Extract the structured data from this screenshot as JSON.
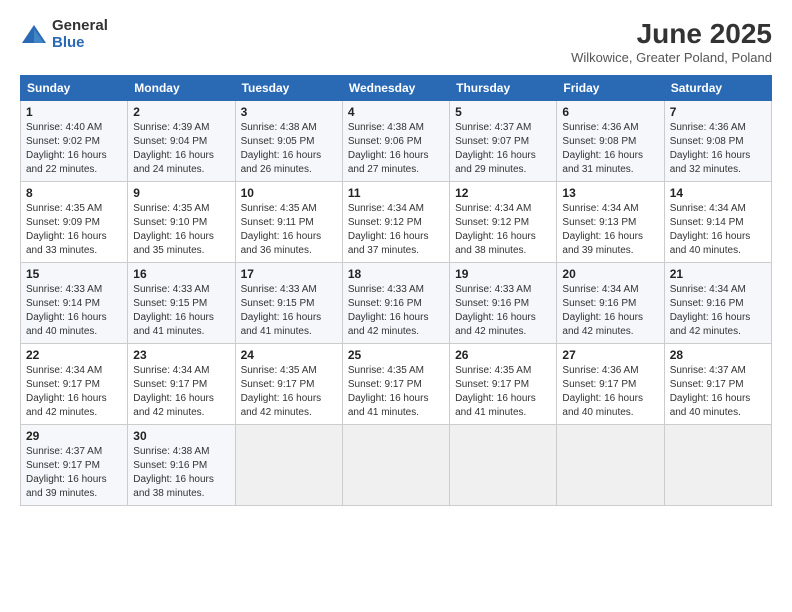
{
  "header": {
    "logo_general": "General",
    "logo_blue": "Blue",
    "month": "June 2025",
    "location": "Wilkowice, Greater Poland, Poland"
  },
  "days_of_week": [
    "Sunday",
    "Monday",
    "Tuesday",
    "Wednesday",
    "Thursday",
    "Friday",
    "Saturday"
  ],
  "weeks": [
    [
      {
        "day": "1",
        "sunrise": "Sunrise: 4:40 AM",
        "sunset": "Sunset: 9:02 PM",
        "daylight": "Daylight: 16 hours and 22 minutes."
      },
      {
        "day": "2",
        "sunrise": "Sunrise: 4:39 AM",
        "sunset": "Sunset: 9:04 PM",
        "daylight": "Daylight: 16 hours and 24 minutes."
      },
      {
        "day": "3",
        "sunrise": "Sunrise: 4:38 AM",
        "sunset": "Sunset: 9:05 PM",
        "daylight": "Daylight: 16 hours and 26 minutes."
      },
      {
        "day": "4",
        "sunrise": "Sunrise: 4:38 AM",
        "sunset": "Sunset: 9:06 PM",
        "daylight": "Daylight: 16 hours and 27 minutes."
      },
      {
        "day": "5",
        "sunrise": "Sunrise: 4:37 AM",
        "sunset": "Sunset: 9:07 PM",
        "daylight": "Daylight: 16 hours and 29 minutes."
      },
      {
        "day": "6",
        "sunrise": "Sunrise: 4:36 AM",
        "sunset": "Sunset: 9:08 PM",
        "daylight": "Daylight: 16 hours and 31 minutes."
      },
      {
        "day": "7",
        "sunrise": "Sunrise: 4:36 AM",
        "sunset": "Sunset: 9:08 PM",
        "daylight": "Daylight: 16 hours and 32 minutes."
      }
    ],
    [
      {
        "day": "8",
        "sunrise": "Sunrise: 4:35 AM",
        "sunset": "Sunset: 9:09 PM",
        "daylight": "Daylight: 16 hours and 33 minutes."
      },
      {
        "day": "9",
        "sunrise": "Sunrise: 4:35 AM",
        "sunset": "Sunset: 9:10 PM",
        "daylight": "Daylight: 16 hours and 35 minutes."
      },
      {
        "day": "10",
        "sunrise": "Sunrise: 4:35 AM",
        "sunset": "Sunset: 9:11 PM",
        "daylight": "Daylight: 16 hours and 36 minutes."
      },
      {
        "day": "11",
        "sunrise": "Sunrise: 4:34 AM",
        "sunset": "Sunset: 9:12 PM",
        "daylight": "Daylight: 16 hours and 37 minutes."
      },
      {
        "day": "12",
        "sunrise": "Sunrise: 4:34 AM",
        "sunset": "Sunset: 9:12 PM",
        "daylight": "Daylight: 16 hours and 38 minutes."
      },
      {
        "day": "13",
        "sunrise": "Sunrise: 4:34 AM",
        "sunset": "Sunset: 9:13 PM",
        "daylight": "Daylight: 16 hours and 39 minutes."
      },
      {
        "day": "14",
        "sunrise": "Sunrise: 4:34 AM",
        "sunset": "Sunset: 9:14 PM",
        "daylight": "Daylight: 16 hours and 40 minutes."
      }
    ],
    [
      {
        "day": "15",
        "sunrise": "Sunrise: 4:33 AM",
        "sunset": "Sunset: 9:14 PM",
        "daylight": "Daylight: 16 hours and 40 minutes."
      },
      {
        "day": "16",
        "sunrise": "Sunrise: 4:33 AM",
        "sunset": "Sunset: 9:15 PM",
        "daylight": "Daylight: 16 hours and 41 minutes."
      },
      {
        "day": "17",
        "sunrise": "Sunrise: 4:33 AM",
        "sunset": "Sunset: 9:15 PM",
        "daylight": "Daylight: 16 hours and 41 minutes."
      },
      {
        "day": "18",
        "sunrise": "Sunrise: 4:33 AM",
        "sunset": "Sunset: 9:16 PM",
        "daylight": "Daylight: 16 hours and 42 minutes."
      },
      {
        "day": "19",
        "sunrise": "Sunrise: 4:33 AM",
        "sunset": "Sunset: 9:16 PM",
        "daylight": "Daylight: 16 hours and 42 minutes."
      },
      {
        "day": "20",
        "sunrise": "Sunrise: 4:34 AM",
        "sunset": "Sunset: 9:16 PM",
        "daylight": "Daylight: 16 hours and 42 minutes."
      },
      {
        "day": "21",
        "sunrise": "Sunrise: 4:34 AM",
        "sunset": "Sunset: 9:16 PM",
        "daylight": "Daylight: 16 hours and 42 minutes."
      }
    ],
    [
      {
        "day": "22",
        "sunrise": "Sunrise: 4:34 AM",
        "sunset": "Sunset: 9:17 PM",
        "daylight": "Daylight: 16 hours and 42 minutes."
      },
      {
        "day": "23",
        "sunrise": "Sunrise: 4:34 AM",
        "sunset": "Sunset: 9:17 PM",
        "daylight": "Daylight: 16 hours and 42 minutes."
      },
      {
        "day": "24",
        "sunrise": "Sunrise: 4:35 AM",
        "sunset": "Sunset: 9:17 PM",
        "daylight": "Daylight: 16 hours and 42 minutes."
      },
      {
        "day": "25",
        "sunrise": "Sunrise: 4:35 AM",
        "sunset": "Sunset: 9:17 PM",
        "daylight": "Daylight: 16 hours and 41 minutes."
      },
      {
        "day": "26",
        "sunrise": "Sunrise: 4:35 AM",
        "sunset": "Sunset: 9:17 PM",
        "daylight": "Daylight: 16 hours and 41 minutes."
      },
      {
        "day": "27",
        "sunrise": "Sunrise: 4:36 AM",
        "sunset": "Sunset: 9:17 PM",
        "daylight": "Daylight: 16 hours and 40 minutes."
      },
      {
        "day": "28",
        "sunrise": "Sunrise: 4:37 AM",
        "sunset": "Sunset: 9:17 PM",
        "daylight": "Daylight: 16 hours and 40 minutes."
      }
    ],
    [
      {
        "day": "29",
        "sunrise": "Sunrise: 4:37 AM",
        "sunset": "Sunset: 9:17 PM",
        "daylight": "Daylight: 16 hours and 39 minutes."
      },
      {
        "day": "30",
        "sunrise": "Sunrise: 4:38 AM",
        "sunset": "Sunset: 9:16 PM",
        "daylight": "Daylight: 16 hours and 38 minutes."
      },
      null,
      null,
      null,
      null,
      null
    ]
  ]
}
